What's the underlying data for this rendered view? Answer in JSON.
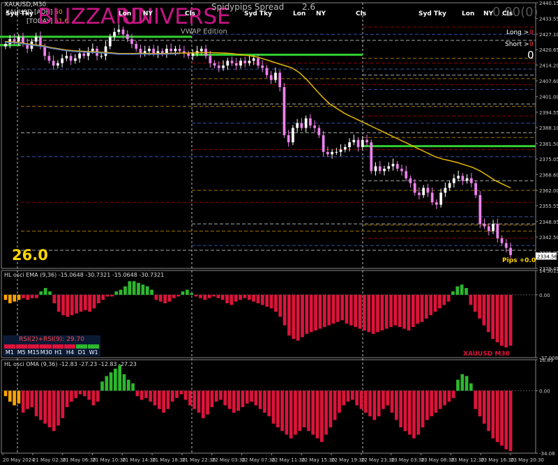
{
  "window": {
    "symbol": "XAUUSD,M30"
  },
  "overlay": {
    "brand_word1": "BLIZZARD",
    "brand_word2": "UNIVERSE",
    "vwap_caption": "VWAP Edition",
    "spread_label": "Spidypips Spread",
    "spread_value": "2.6",
    "pnl_value": "0.00(0)",
    "long_label": "Long >",
    "long_value": "0",
    "short_label": "Short >",
    "short_value": "0",
    "position_count": "0",
    "big_value": "26.0",
    "pips_label": "Pips +0.0",
    "adr_label": "XAUUSD [ADR]",
    "adr_value": "50",
    "today_label": "[TODAY]",
    "today_value": "51.6",
    "price_box": "2334.56"
  },
  "session_labels": [
    "Syd Tky",
    "Lon",
    "NY",
    "Cls",
    "Syd Tky",
    "Lon",
    "NY",
    "Cls",
    "Syd Tky",
    "Lon",
    "NY",
    "Cls"
  ],
  "colors": {
    "bull_candle": "#ffffff",
    "bear_candle": "#ee82ee",
    "ma_line": "#e6b800",
    "ma_line2": "#5b7ccf",
    "vwap_level": "#32cd32",
    "bull_hist": "#2db82d",
    "bear_hist": "#dc143c",
    "warn_hist": "#ffa500",
    "brand": "#c71585"
  },
  "chart_data": [
    {
      "type": "candlestick",
      "title": "XAUUSD,M30",
      "y_axis_ticks": [
        2440.15,
        2433.55,
        2427.1,
        2420.65,
        2414.2,
        2407.6,
        2401.0,
        2394.55,
        2388.1,
        2381.5,
        2375.05,
        2368.6,
        2362.0,
        2355.55,
        2348.95,
        2342.5,
        2336.05,
        2329.45
      ],
      "ylim": [
        2329.45,
        2440.15
      ],
      "last_price": 2334.56,
      "close_series": [
        2423,
        2425,
        2424,
        2426,
        2423,
        2421,
        2424,
        2426,
        2422,
        2418,
        2416,
        2414,
        2415,
        2417,
        2418,
        2416,
        2417,
        2419,
        2418,
        2420,
        2421,
        2418,
        2418,
        2422,
        2426,
        2428,
        2429,
        2427,
        2425,
        2423,
        2421,
        2419,
        2420,
        2421,
        2419,
        2420,
        2419,
        2421,
        2420,
        2421,
        2420,
        2419,
        2418,
        2419,
        2420,
        2421,
        2418,
        2415,
        2414,
        2413,
        2414,
        2416,
        2415,
        2414,
        2416,
        2415,
        2416,
        2417,
        2414,
        2413,
        2410,
        2408,
        2411,
        2405,
        2385,
        2382,
        2388,
        2390,
        2388,
        2392,
        2389,
        2388,
        2385,
        2378,
        2377,
        2378,
        2378,
        2379,
        2380,
        2382,
        2383,
        2380,
        2383,
        2382,
        2370,
        2372,
        2370,
        2371,
        2372,
        2373,
        2371,
        2370,
        2367,
        2365,
        2361,
        2360,
        2363,
        2361,
        2357,
        2356,
        2361,
        2363,
        2365,
        2367,
        2368,
        2366,
        2367,
        2365,
        2360,
        2348,
        2347,
        2345,
        2348,
        2342,
        2340,
        2338,
        2335
      ],
      "moving_average": [
        2424,
        2423.8,
        2423.5,
        2423,
        2422.6,
        2422.2,
        2421.5,
        2421,
        2420.5,
        2420.2,
        2420,
        2419.8,
        2419.7,
        2419.5,
        2419.3,
        2419,
        2419,
        2419,
        2419.1,
        2419,
        2419,
        2419,
        2419.1,
        2419.2,
        2419.2,
        2419.3,
        2419.4,
        2419.4,
        2419.3,
        2419.2,
        2419,
        2418.6,
        2418.2,
        2417.8,
        2417,
        2416,
        2415,
        2414,
        2413,
        2411,
        2408,
        2404.5,
        2401,
        2398,
        2396,
        2394,
        2392.5,
        2391,
        2389.5,
        2388,
        2386.5,
        2385,
        2383.5,
        2382,
        2380.5,
        2379,
        2377.5,
        2376,
        2375,
        2374.3,
        2373.5,
        2372.5,
        2371.5,
        2370,
        2368,
        2366,
        2364.5,
        2363
      ],
      "levels_green": [
        2426,
        2422.5,
        2418.5,
        2380.4
      ],
      "levels_dashed": [
        2430,
        2427,
        2424.5,
        2417,
        2415,
        2412.5,
        2410,
        2408.5,
        2406,
        2404,
        2398,
        2397,
        2393,
        2390,
        2386,
        2384,
        2379,
        2376,
        2366,
        2362,
        2357,
        2351,
        2348,
        2345,
        2342,
        2339,
        2337,
        2347.5
      ]
    },
    {
      "type": "bar",
      "title": "HL osci EMA (9,36) -15.0648 -30.7321 -15.0648 -30.7321",
      "y_axis_ticks": [
        14.3013,
        0.0,
        -37.0085
      ],
      "ylim": [
        -37.0085,
        14.3013
      ],
      "values": [
        -3,
        -5,
        -4,
        -3,
        -2,
        -3,
        -2,
        -2,
        2,
        4,
        2,
        -5,
        -10,
        -12,
        -13,
        -12,
        -11,
        -10,
        -9,
        -10,
        -8,
        -5,
        -3,
        -1,
        -1,
        2,
        3,
        5,
        8,
        8,
        7,
        6,
        5,
        3,
        -3,
        -4,
        -5,
        -4,
        -2,
        -1,
        2,
        3,
        1,
        -1,
        -2,
        -3,
        -2,
        -1,
        -2,
        -3,
        -5,
        -6,
        -4,
        -3,
        -2,
        -3,
        -4,
        -5,
        -6,
        -7,
        -8,
        -10,
        -13,
        -18,
        -24,
        -26,
        -27,
        -25,
        -23,
        -22,
        -21,
        -20,
        -19,
        -18,
        -17,
        -16,
        -15,
        -17,
        -18,
        -19,
        -20,
        -21,
        -22,
        -23,
        -22,
        -21,
        -20,
        -19,
        -18,
        -19,
        -20,
        -21,
        -19,
        -17,
        -16,
        -14,
        -12,
        -10,
        -8,
        -6,
        -4,
        2,
        5,
        6,
        4,
        -6,
        -10,
        -14,
        -18,
        -22,
        -26,
        -28,
        -30,
        -31,
        -30
      ],
      "indicator": "RSI(2)+RSI(9): 29.70",
      "timeframes": [
        "M1",
        "M5",
        "M15",
        "M30",
        "H1",
        "H4",
        "D1",
        "W1"
      ],
      "tf_colors": [
        "#dc143c",
        "#dc143c",
        "#dc143c",
        "#dc143c",
        "#dc143c",
        "#dc143c",
        "#2db82d",
        "#2db82d"
      ],
      "symbol_label": "XAUUSD M30"
    },
    {
      "type": "bar",
      "title": "HL osci OMA (9,36) -12.83 -27.23 -12.83 -27.23",
      "y_axis_ticks": [
        16.89,
        0.0,
        -34.08
      ],
      "ylim": [
        -34.08,
        16.89
      ],
      "values": [
        -3,
        -6,
        -8,
        -7,
        -12,
        -10,
        -9,
        -14,
        -16,
        -18,
        -20,
        -22,
        -19,
        -15,
        -9,
        -6,
        -4,
        -2,
        -3,
        -5,
        -8,
        -6,
        5,
        8,
        10,
        12,
        14,
        9,
        6,
        4,
        -3,
        -5,
        -4,
        -6,
        -8,
        -10,
        -12,
        -10,
        -6,
        -4,
        -2,
        -5,
        -8,
        -10,
        -12,
        -15,
        -13,
        -9,
        -6,
        -5,
        -8,
        -10,
        -12,
        -11,
        -9,
        -7,
        -6,
        -8,
        -10,
        -12,
        -14,
        -18,
        -20,
        -22,
        -24,
        -26,
        -24,
        -22,
        -20,
        -22,
        -24,
        -26,
        -28,
        -24,
        -20,
        -16,
        -12,
        -8,
        -6,
        -5,
        -8,
        -10,
        -12,
        -14,
        -16,
        -14,
        -10,
        -8,
        -12,
        -16,
        -20,
        -22,
        -24,
        -26,
        -24,
        -20,
        -16,
        -14,
        -12,
        -10,
        -8,
        -6,
        -4,
        6,
        9,
        8,
        4,
        -10,
        -14,
        -18,
        -22,
        -26,
        -28,
        -30,
        -32,
        -33
      ],
      "x_tick_labels": [
        "20 May 2024",
        "21 May 02:30",
        "21 May 06:30",
        "21 May 10:30",
        "21 May 14:30",
        "21 May 18:30",
        "21 May 22:30",
        "22 May 03:30",
        "22 May 07:30",
        "22 May 11:30",
        "22 May 15:30",
        "22 May 19:30",
        "22 May 23:30",
        "23 May 03:30",
        "23 May 08:30",
        "23 May 12:30",
        "23 May 16:30",
        "23 May 20:30"
      ]
    }
  ]
}
